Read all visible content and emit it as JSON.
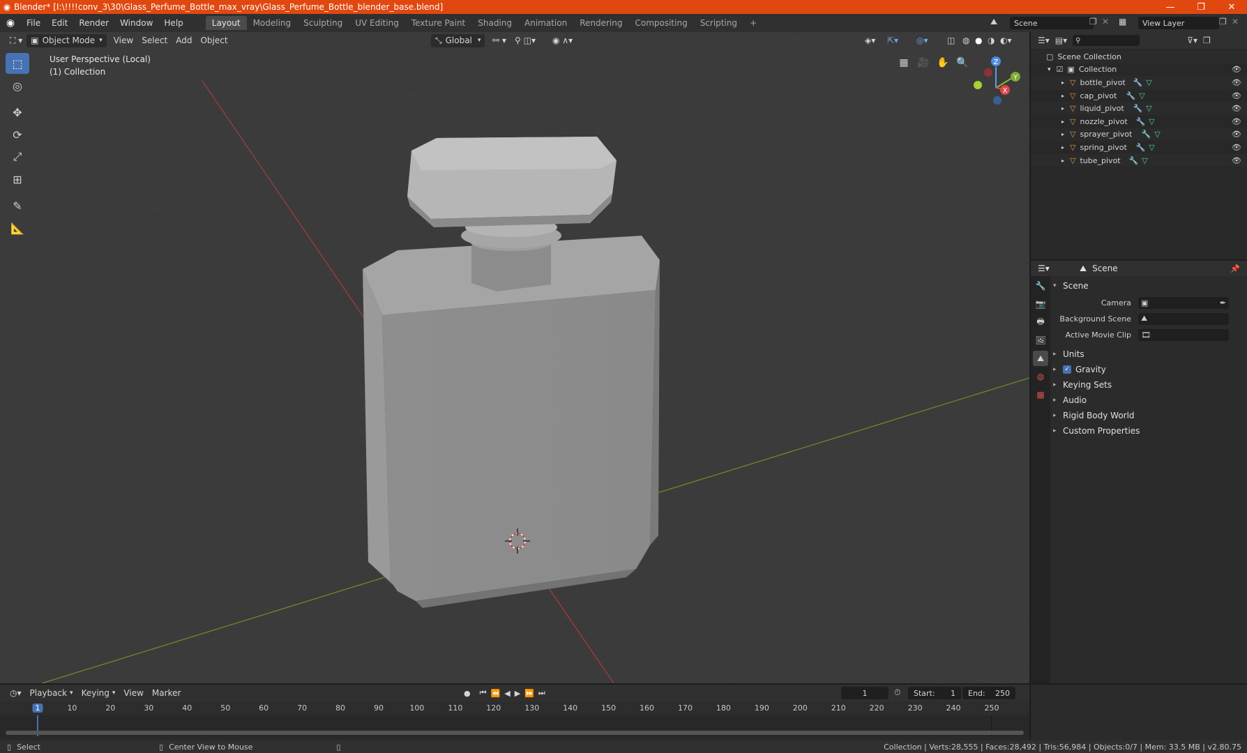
{
  "titlebar": {
    "text": "Blender* [I:\\!!!!conv_3\\30\\Glass_Perfume_Bottle_max_vray\\Glass_Perfume_Bottle_blender_base.blend]",
    "minimize": "—",
    "restore": "❐",
    "close": "✕"
  },
  "menu": {
    "items": [
      "File",
      "Edit",
      "Render",
      "Window",
      "Help"
    ],
    "workspaces": [
      "Layout",
      "Modeling",
      "Sculpting",
      "UV Editing",
      "Texture Paint",
      "Shading",
      "Animation",
      "Rendering",
      "Compositing",
      "Scripting"
    ],
    "add_tab": "+",
    "scene": "Scene",
    "view_layer": "View Layer"
  },
  "viewport": {
    "mode": "Object Mode",
    "menus": [
      "View",
      "Select",
      "Add",
      "Object"
    ],
    "orientation": "Global",
    "perspective_label": "User Perspective (Local)",
    "collection_label": "(1) Collection",
    "gizmo": {
      "z": "Z",
      "y": "Y",
      "x": "X"
    }
  },
  "outliner": {
    "root": "Scene Collection",
    "collection": "Collection",
    "objects": [
      "bottle_pivot",
      "cap_pivot",
      "liquid_pivot",
      "nozzle_pivot",
      "sprayer_pivot",
      "spring_pivot",
      "tube_pivot"
    ]
  },
  "properties": {
    "header": "Scene",
    "panel_title": "Scene",
    "camera_label": "Camera",
    "background_scene_label": "Background Scene",
    "active_movie_clip_label": "Active Movie Clip",
    "sections": [
      "Units",
      "Gravity",
      "Keying Sets",
      "Audio",
      "Rigid Body World",
      "Custom Properties"
    ]
  },
  "timeline": {
    "menus": [
      "Playback",
      "Keying",
      "View",
      "Marker"
    ],
    "current_frame": "1",
    "start_label": "Start:",
    "start_value": "1",
    "end_label": "End:",
    "end_value": "250",
    "ruler": [
      "1",
      "10",
      "20",
      "30",
      "40",
      "50",
      "60",
      "70",
      "80",
      "90",
      "100",
      "110",
      "120",
      "130",
      "140",
      "150",
      "160",
      "170",
      "180",
      "190",
      "200",
      "210",
      "220",
      "230",
      "240",
      "250"
    ]
  },
  "statusbar": {
    "select": "Select",
    "center_view": "Center View to Mouse",
    "stats": "Collection | Verts:28,555 | Faces:28,492 | Tris:56,984 | Objects:0/7 | Mem: 33.5 MB | v2.80.75"
  },
  "colors": {
    "accent": "#4772b3",
    "titlebar": "#e0480f",
    "object_icon": "#e99440"
  }
}
